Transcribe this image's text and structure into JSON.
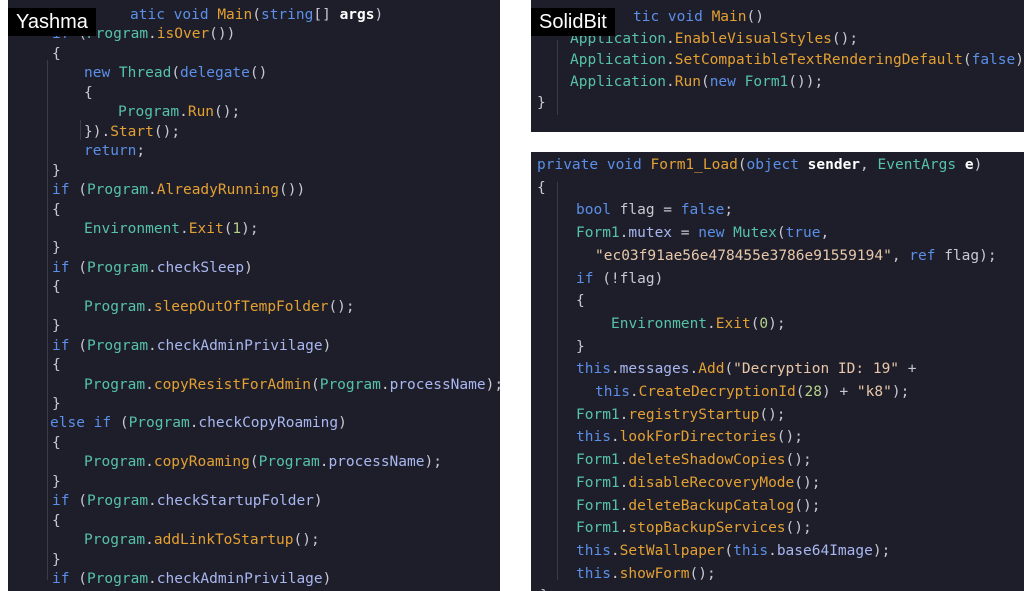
{
  "labels": {
    "yashma": "Yashma",
    "solidbit": "SolidBit"
  },
  "colors": {
    "background": "#1e1e2a",
    "keyword": "#5b8fe8",
    "type": "#56c2a8",
    "method": "#e3a033",
    "member": "#a9b7f0",
    "string": "#e8c7a8",
    "number": "#b5d28a",
    "badge": "#000000"
  },
  "panels": [
    {
      "id": "yashma",
      "lines": [
        [
          [
            "kw",
            "atic void "
          ],
          [
            "fn",
            "Main"
          ],
          [
            "plain",
            "("
          ],
          [
            "kw",
            "string"
          ],
          [
            "plain",
            "[] "
          ],
          [
            "bold",
            "args"
          ],
          [
            "plain",
            ")"
          ]
        ],
        [
          [
            "kw",
            "if "
          ],
          [
            "plain",
            "("
          ],
          [
            "type",
            "Program"
          ],
          [
            "plain",
            "."
          ],
          [
            "fn",
            "isOver"
          ],
          [
            "plain",
            "())"
          ]
        ],
        [
          [
            "plain",
            "{"
          ]
        ],
        [
          [
            "kw",
            "new "
          ],
          [
            "type",
            "Thread"
          ],
          [
            "plain",
            "("
          ],
          [
            "kw",
            "delegate"
          ],
          [
            "plain",
            "()"
          ]
        ],
        [
          [
            "plain",
            "{"
          ]
        ],
        [
          [
            "type",
            "Program"
          ],
          [
            "plain",
            "."
          ],
          [
            "fn",
            "Run"
          ],
          [
            "plain",
            "();"
          ]
        ],
        [
          [
            "plain",
            "})."
          ],
          [
            "fn",
            "Start"
          ],
          [
            "plain",
            "();"
          ]
        ],
        [
          [
            "kw",
            "return"
          ],
          [
            "plain",
            ";"
          ]
        ],
        [
          [
            "plain",
            "}"
          ]
        ],
        [
          [
            "kw",
            "if "
          ],
          [
            "plain",
            "("
          ],
          [
            "type",
            "Program"
          ],
          [
            "plain",
            "."
          ],
          [
            "fn",
            "AlreadyRunning"
          ],
          [
            "plain",
            "())"
          ]
        ],
        [
          [
            "plain",
            "{"
          ]
        ],
        [
          [
            "type",
            "Environment"
          ],
          [
            "plain",
            "."
          ],
          [
            "fn",
            "Exit"
          ],
          [
            "plain",
            "("
          ],
          [
            "num",
            "1"
          ],
          [
            "plain",
            ");"
          ]
        ],
        [
          [
            "plain",
            "}"
          ]
        ],
        [
          [
            "kw",
            "if "
          ],
          [
            "plain",
            "("
          ],
          [
            "type",
            "Program"
          ],
          [
            "plain",
            "."
          ],
          [
            "var",
            "checkSleep"
          ],
          [
            "plain",
            ")"
          ]
        ],
        [
          [
            "plain",
            "{"
          ]
        ],
        [
          [
            "type",
            "Program"
          ],
          [
            "plain",
            "."
          ],
          [
            "fn",
            "sleepOutOfTempFolder"
          ],
          [
            "plain",
            "();"
          ]
        ],
        [
          [
            "plain",
            "}"
          ]
        ],
        [
          [
            "kw",
            "if "
          ],
          [
            "plain",
            "("
          ],
          [
            "type",
            "Program"
          ],
          [
            "plain",
            "."
          ],
          [
            "var",
            "checkAdminPrivilage"
          ],
          [
            "plain",
            ")"
          ]
        ],
        [
          [
            "plain",
            "{"
          ]
        ],
        [
          [
            "type",
            "Program"
          ],
          [
            "plain",
            "."
          ],
          [
            "fn",
            "copyResistForAdmin"
          ],
          [
            "plain",
            "("
          ],
          [
            "type",
            "Program"
          ],
          [
            "plain",
            "."
          ],
          [
            "var",
            "processName"
          ],
          [
            "plain",
            ");"
          ]
        ],
        [
          [
            "plain",
            "}"
          ]
        ],
        [
          [
            "kw",
            "else if "
          ],
          [
            "plain",
            "("
          ],
          [
            "type",
            "Program"
          ],
          [
            "plain",
            "."
          ],
          [
            "var",
            "checkCopyRoaming"
          ],
          [
            "plain",
            ")"
          ]
        ],
        [
          [
            "plain",
            "{"
          ]
        ],
        [
          [
            "type",
            "Program"
          ],
          [
            "plain",
            "."
          ],
          [
            "fn",
            "copyRoaming"
          ],
          [
            "plain",
            "("
          ],
          [
            "type",
            "Program"
          ],
          [
            "plain",
            "."
          ],
          [
            "var",
            "processName"
          ],
          [
            "plain",
            ");"
          ]
        ],
        [
          [
            "plain",
            "}"
          ]
        ],
        [
          [
            "kw",
            "if "
          ],
          [
            "plain",
            "("
          ],
          [
            "type",
            "Program"
          ],
          [
            "plain",
            "."
          ],
          [
            "var",
            "checkStartupFolder"
          ],
          [
            "plain",
            ")"
          ]
        ],
        [
          [
            "plain",
            "{"
          ]
        ],
        [
          [
            "type",
            "Program"
          ],
          [
            "plain",
            "."
          ],
          [
            "fn",
            "addLinkToStartup"
          ],
          [
            "plain",
            "();"
          ]
        ],
        [
          [
            "plain",
            "}"
          ]
        ],
        [
          [
            "kw",
            "if "
          ],
          [
            "plain",
            "("
          ],
          [
            "type",
            "Program"
          ],
          [
            "plain",
            "."
          ],
          [
            "var",
            "checkAdminPrivilage"
          ],
          [
            "plain",
            ")"
          ]
        ]
      ]
    },
    {
      "id": "solidbit-main",
      "lines": [
        [
          [
            "kw",
            "tic void "
          ],
          [
            "fn",
            "Main"
          ],
          [
            "plain",
            "()"
          ]
        ],
        [
          [
            "type",
            "Application"
          ],
          [
            "plain",
            "."
          ],
          [
            "fn",
            "EnableVisualStyles"
          ],
          [
            "plain",
            "();"
          ]
        ],
        [
          [
            "type",
            "Application"
          ],
          [
            "plain",
            "."
          ],
          [
            "fn",
            "SetCompatibleTextRenderingDefault"
          ],
          [
            "plain",
            "("
          ],
          [
            "kw",
            "false"
          ],
          [
            "plain",
            ");"
          ]
        ],
        [
          [
            "type",
            "Application"
          ],
          [
            "plain",
            "."
          ],
          [
            "fn",
            "Run"
          ],
          [
            "plain",
            "("
          ],
          [
            "kw",
            "new "
          ],
          [
            "type",
            "Form1"
          ],
          [
            "plain",
            "());"
          ]
        ],
        [
          [
            "plain",
            "}"
          ]
        ]
      ]
    },
    {
      "id": "solidbit-load",
      "lines": [
        [
          [
            "kw",
            "private void "
          ],
          [
            "fn",
            "Form1_Load"
          ],
          [
            "plain",
            "("
          ],
          [
            "kw",
            "object "
          ],
          [
            "bold",
            "sender"
          ],
          [
            "plain",
            ", "
          ],
          [
            "type",
            "EventArgs "
          ],
          [
            "bold",
            "e"
          ],
          [
            "plain",
            ")"
          ]
        ],
        [
          [
            "plain",
            "{"
          ]
        ],
        [
          [
            "kw",
            "bool "
          ],
          [
            "plain",
            "flag = "
          ],
          [
            "kw",
            "false"
          ],
          [
            "plain",
            ";"
          ]
        ],
        [
          [
            "type",
            "Form1"
          ],
          [
            "plain",
            "."
          ],
          [
            "var",
            "mutex"
          ],
          [
            "plain",
            " = "
          ],
          [
            "kw",
            "new "
          ],
          [
            "type",
            "Mutex"
          ],
          [
            "plain",
            "("
          ],
          [
            "kw",
            "true"
          ],
          [
            "plain",
            ","
          ]
        ],
        [
          [
            "str",
            "\"ec03f91ae56e478455e3786e91559194\""
          ],
          [
            "plain",
            ", "
          ],
          [
            "kw",
            "ref "
          ],
          [
            "plain",
            "flag);"
          ]
        ],
        [
          [
            "kw",
            "if "
          ],
          [
            "plain",
            "(!flag)"
          ]
        ],
        [
          [
            "plain",
            "{"
          ]
        ],
        [
          [
            "type",
            "Environment"
          ],
          [
            "plain",
            "."
          ],
          [
            "fn",
            "Exit"
          ],
          [
            "plain",
            "("
          ],
          [
            "num",
            "0"
          ],
          [
            "plain",
            ");"
          ]
        ],
        [
          [
            "plain",
            "}"
          ]
        ],
        [
          [
            "kw",
            "this"
          ],
          [
            "plain",
            "."
          ],
          [
            "var",
            "messages"
          ],
          [
            "plain",
            "."
          ],
          [
            "fn",
            "Add"
          ],
          [
            "plain",
            "("
          ],
          [
            "str",
            "\"Decryption ID: 19\""
          ],
          [
            "plain",
            " +"
          ]
        ],
        [
          [
            "kw",
            "this"
          ],
          [
            "plain",
            "."
          ],
          [
            "fn",
            "CreateDecryptionId"
          ],
          [
            "plain",
            "("
          ],
          [
            "num",
            "28"
          ],
          [
            "plain",
            ") + "
          ],
          [
            "str",
            "\"k8\""
          ],
          [
            "plain",
            ");"
          ]
        ],
        [
          [
            "type",
            "Form1"
          ],
          [
            "plain",
            "."
          ],
          [
            "fn",
            "registryStartup"
          ],
          [
            "plain",
            "();"
          ]
        ],
        [
          [
            "kw",
            "this"
          ],
          [
            "plain",
            "."
          ],
          [
            "fn",
            "lookForDirectories"
          ],
          [
            "plain",
            "();"
          ]
        ],
        [
          [
            "type",
            "Form1"
          ],
          [
            "plain",
            "."
          ],
          [
            "fn",
            "deleteShadowCopies"
          ],
          [
            "plain",
            "();"
          ]
        ],
        [
          [
            "type",
            "Form1"
          ],
          [
            "plain",
            "."
          ],
          [
            "fn",
            "disableRecoveryMode"
          ],
          [
            "plain",
            "();"
          ]
        ],
        [
          [
            "type",
            "Form1"
          ],
          [
            "plain",
            "."
          ],
          [
            "fn",
            "deleteBackupCatalog"
          ],
          [
            "plain",
            "();"
          ]
        ],
        [
          [
            "type",
            "Form1"
          ],
          [
            "plain",
            "."
          ],
          [
            "fn",
            "stopBackupServices"
          ],
          [
            "plain",
            "();"
          ]
        ],
        [
          [
            "kw",
            "this"
          ],
          [
            "plain",
            "."
          ],
          [
            "fn",
            "SetWallpaper"
          ],
          [
            "plain",
            "("
          ],
          [
            "kw",
            "this"
          ],
          [
            "plain",
            "."
          ],
          [
            "var",
            "base64Image"
          ],
          [
            "plain",
            ");"
          ]
        ],
        [
          [
            "kw",
            "this"
          ],
          [
            "plain",
            "."
          ],
          [
            "fn",
            "showForm"
          ],
          [
            "plain",
            "();"
          ]
        ],
        [
          [
            "plain",
            "}"
          ]
        ]
      ]
    }
  ]
}
